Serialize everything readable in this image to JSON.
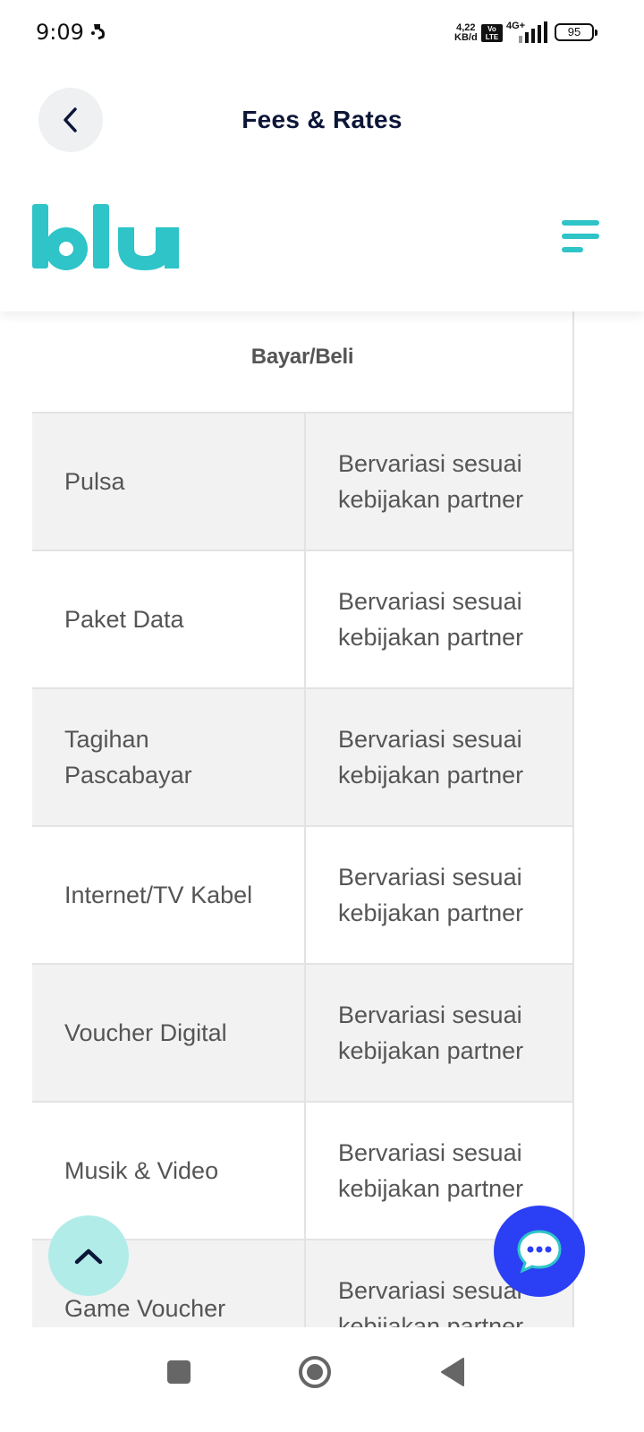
{
  "status_bar": {
    "time": "9:09",
    "net_speed_value": "4,22",
    "net_speed_unit": "KB/d",
    "volte_top": "Vo",
    "volte_bottom": "LTE",
    "network_type": "4G+",
    "battery": "95"
  },
  "header": {
    "title": "Fees & Rates",
    "back_icon": "chevron-left-icon"
  },
  "banner": {
    "logo_text": "blu",
    "menu_icon": "hamburger-menu-icon"
  },
  "table": {
    "section_title": "Bayar/Beli",
    "rows": [
      {
        "name": "Pulsa",
        "value": "Bervariasi sesuai kebijakan partner"
      },
      {
        "name": "Paket Data",
        "value": "Bervariasi sesuai kebijakan partner"
      },
      {
        "name": "Tagihan Pascabayar",
        "value": "Bervariasi sesuai kebijakan partner"
      },
      {
        "name": "Internet/TV Kabel",
        "value": "Bervariasi sesuai kebijakan partner"
      },
      {
        "name": "Voucher Digital",
        "value": "Bervariasi sesuai kebijakan partner"
      },
      {
        "name": "Musik & Video",
        "value": "Bervariasi sesuai kebijakan partner"
      },
      {
        "name": "Game Voucher",
        "value": "Bervariasi sesuai kebijakan partner"
      }
    ]
  },
  "colors": {
    "brand_teal": "#2ec4c8",
    "title_navy": "#0c1637",
    "chat_blue": "#2b3ff5",
    "scroll_top_bg": "#b2ece9",
    "row_shade": "#f2f2f2"
  },
  "floating": {
    "scroll_top_icon": "chevron-up-icon",
    "chat_icon": "chat-bubble-icon"
  },
  "nav": {
    "recents_icon": "square-icon",
    "home_icon": "circle-icon",
    "back_icon": "triangle-back-icon"
  }
}
